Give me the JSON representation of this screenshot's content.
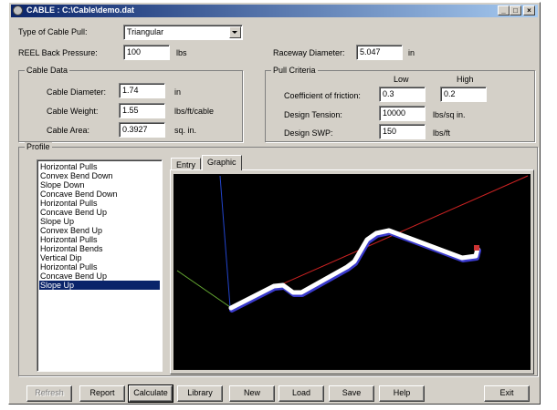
{
  "window": {
    "title": "CABLE : C:\\Cable\\demo.dat"
  },
  "controls": {
    "minimize": "_",
    "maximize": "□",
    "close": "×"
  },
  "top": {
    "type_label": "Type of Cable Pull:",
    "type_value": "Triangular",
    "reel_label": "REEL Back Pressure:",
    "reel_value": "100",
    "reel_unit": "lbs",
    "raceway_label": "Raceway Diameter:",
    "raceway_value": "5.047",
    "raceway_unit": "in"
  },
  "cable_data": {
    "title": "Cable Data",
    "diameter_label": "Cable Diameter:",
    "diameter_value": "1.74",
    "diameter_unit": "in",
    "weight_label": "Cable Weight:",
    "weight_value": "1.55",
    "weight_unit": "lbs/ft/cable",
    "area_label": "Cable Area:",
    "area_value": "0.3927",
    "area_unit": "sq. in."
  },
  "pull_criteria": {
    "title": "Pull Criteria",
    "low_header": "Low",
    "high_header": "High",
    "friction_label": "Coefficient of friction:",
    "friction_low": "0.3",
    "friction_high": "0.2",
    "tension_label": "Design Tension:",
    "tension_value": "10000",
    "tension_unit": "lbs/sq in.",
    "swp_label": "Design SWP:",
    "swp_value": "150",
    "swp_unit": "lbs/ft"
  },
  "profile": {
    "title": "Profile",
    "items": [
      "Horizontal Pulls",
      "Convex Bend Down",
      "Slope Down",
      "Concave Bend Down",
      "Horizontal Pulls",
      "Concave Bend Up",
      "Slope Up",
      "Convex Bend Up",
      "Horizontal Pulls",
      "Horizontal Bends",
      "Vertical Dip",
      "Horizontal Pulls",
      "Concave Bend Up",
      "Slope Up"
    ],
    "selected_index": 13,
    "tabs": [
      "Entry",
      "Graphic"
    ],
    "active_tab": "Graphic"
  },
  "buttons": {
    "refresh": "Refresh",
    "report": "Report",
    "calculate": "Calculate",
    "library": "Library",
    "new": "New",
    "load": "Load",
    "save": "Save",
    "help": "Help",
    "exit": "Exit"
  },
  "colors": {
    "titlebar_start": "#0a246a",
    "titlebar_end": "#a6caf0",
    "face": "#d4d0c8",
    "selection": "#0a246a",
    "canvas": "#000000",
    "cable": "#ffffff",
    "cable_shadow": "#3a3acc",
    "axis_x": "#cc2222",
    "axis_y": "#2244cc",
    "axis_z": "#66aa33"
  }
}
